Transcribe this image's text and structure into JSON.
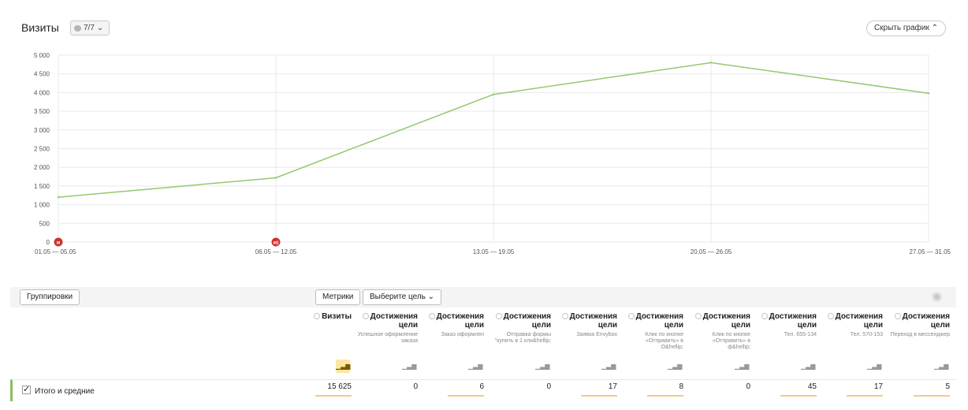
{
  "header": {
    "title": "Визиты",
    "annotations_count": "7/7",
    "hide_chart_label": "Скрыть график"
  },
  "chart_data": {
    "type": "line",
    "categories": [
      "01.05 — 05.05",
      "06.05 — 12.05",
      "13.05 — 19.05",
      "20.05 — 26.05",
      "27.05 — 31.05"
    ],
    "series": [
      {
        "values": [
          1200,
          1720,
          3950,
          4800,
          3980
        ]
      }
    ],
    "ylim": [
      0,
      5000
    ],
    "yticks": [
      "0",
      "500",
      "1 000",
      "1 500",
      "2 000",
      "2 500",
      "3 000",
      "3 500",
      "4 000",
      "4 500",
      "5 000"
    ],
    "grid": true,
    "line_color": "#91c96e",
    "annotation_markers": [
      {
        "category": "01.05 — 05.05",
        "label": "м"
      },
      {
        "category": "06.05 — 12.05",
        "label": "м)"
      }
    ],
    "marker_color": "#d0312d"
  },
  "toolbar": {
    "groupings_label": "Группировки",
    "metrics_label": "Метрики",
    "choose_goal_label": "Выберите цель"
  },
  "columns": [
    {
      "title": "Визиты",
      "sub": ""
    },
    {
      "title": "Достижения цели",
      "sub": "Успешное оформление заказа"
    },
    {
      "title": "Достижения цели",
      "sub": "Заказ оформлен"
    },
    {
      "title": "Достижения цели",
      "sub": "Отправка формы \"купить в 1 кли&hellip;"
    },
    {
      "title": "Достижения цели",
      "sub": "Заявка Envybox"
    },
    {
      "title": "Достижения цели",
      "sub": "Клик по кнопке «Отправить» в О&hellip;"
    },
    {
      "title": "Достижения цели",
      "sub": "Клик по кнопке «Отправить» в ф&hellip;"
    },
    {
      "title": "Достижения цели",
      "sub": "Тел. 655-134"
    },
    {
      "title": "Достижения цели",
      "sub": "Тел. 570-153"
    },
    {
      "title": "Достижения цели",
      "sub": "Переход в мессенджер"
    }
  ],
  "totals": {
    "label": "Итого и средние",
    "values": [
      "15 625",
      "0",
      "6",
      "0",
      "17",
      "8",
      "0",
      "45",
      "17",
      "5"
    ]
  }
}
